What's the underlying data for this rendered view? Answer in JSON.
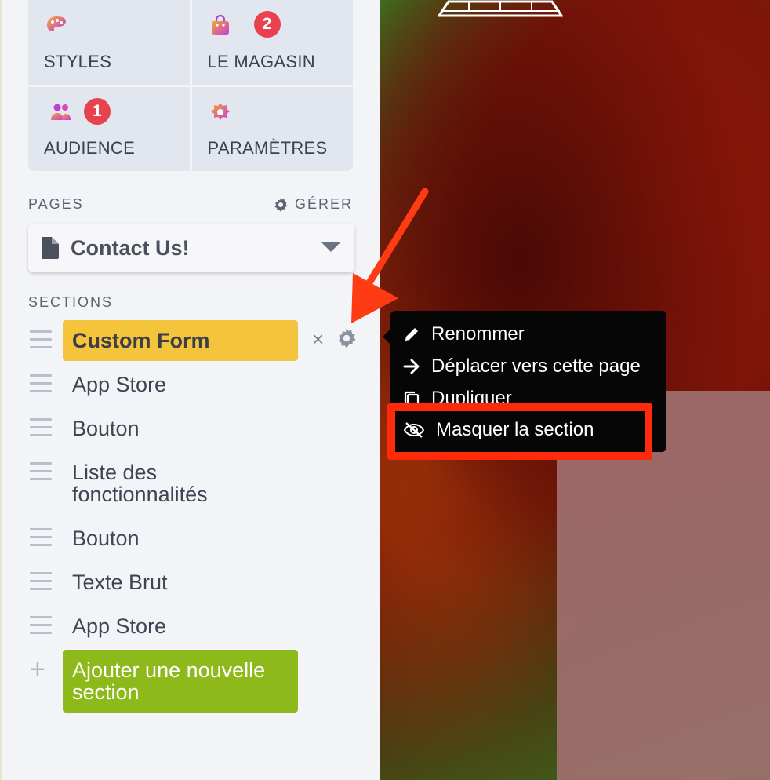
{
  "tiles": [
    {
      "label": "STYLES",
      "icon": "palette-icon",
      "badge": ""
    },
    {
      "label": "LE MAGASIN",
      "icon": "shopping-bag-icon",
      "badge": "2"
    },
    {
      "label": "AUDIENCE",
      "icon": "people-icon",
      "badge": "1"
    },
    {
      "label": "PARAMÈTRES",
      "icon": "settings-flower-icon",
      "badge": ""
    }
  ],
  "pages": {
    "heading": "PAGES",
    "manage_label": "GÉRER",
    "selected_page": "Contact Us!"
  },
  "sections": {
    "heading": "SECTIONS",
    "items": [
      {
        "label": "Custom Form",
        "active": true
      },
      {
        "label": "App Store"
      },
      {
        "label": "Bouton"
      },
      {
        "label": "Liste des fonctionnalités"
      },
      {
        "label": "Bouton"
      },
      {
        "label": "Texte Brut"
      },
      {
        "label": "App Store"
      }
    ],
    "add_label": "Ajouter une nouvelle section",
    "remove_symbol": "×",
    "add_symbol": "+"
  },
  "context_menu": {
    "items": [
      {
        "label": "Renommer",
        "icon": "pencil-icon"
      },
      {
        "label": "Déplacer vers cette page",
        "icon": "arrow-right-icon"
      },
      {
        "label": "Dupliquer",
        "icon": "duplicate-icon"
      },
      {
        "label": "Masquer la section",
        "icon": "eye-slash-icon"
      }
    ],
    "highlighted_index": 3
  },
  "colors": {
    "active_section": "#f4c43c",
    "add_button": "#8db91b",
    "badge": "#e8424f",
    "annotation": "#ff2a0a"
  }
}
